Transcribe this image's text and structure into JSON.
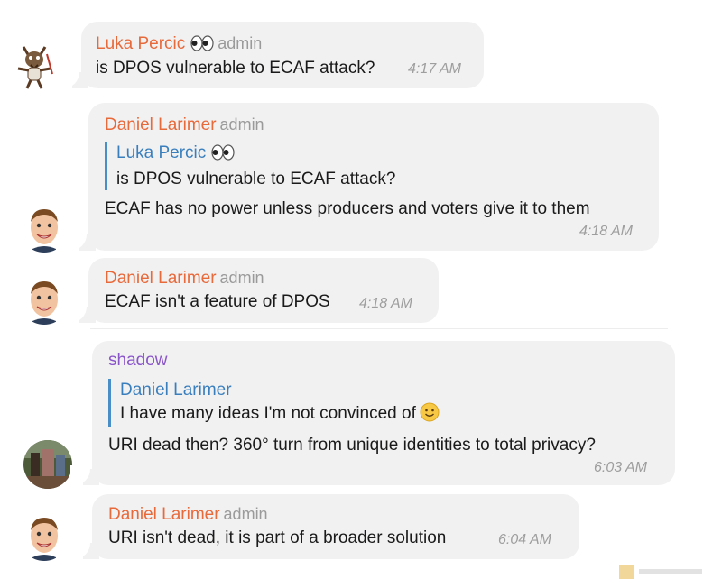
{
  "messages": [
    {
      "sender": "Luka Percic",
      "sender_emoji": "eyes-emoji",
      "role": "admin",
      "text": "is DPOS vulnerable to ECAF attack?",
      "time": "4:17 AM",
      "avatar": "cartoon-goat-avatar"
    },
    {
      "sender": "Daniel Larimer",
      "role": "admin",
      "reply_to": {
        "sender": "Luka Percic",
        "sender_emoji": "eyes-emoji",
        "text": "is DPOS vulnerable to ECAF attack?"
      },
      "text": "ECAF has no power unless producers and voters give it to them",
      "time": "4:18 AM",
      "avatar": "cartoon-man-avatar"
    },
    {
      "sender": "Daniel Larimer",
      "role": "admin",
      "text": "ECAF isn't a feature of DPOS",
      "time": "4:18 AM",
      "avatar": "cartoon-man-avatar"
    },
    {
      "sender": "shadow",
      "role": "",
      "reply_to": {
        "sender": "Daniel Larimer",
        "text": "I have many ideas I'm not convinced of",
        "text_emoji": "smiley-emoji"
      },
      "text": "URI dead then? 360° turn from unique identities to total privacy?",
      "time": "6:03 AM",
      "avatar": "photo-avatar"
    },
    {
      "sender": "Daniel Larimer",
      "role": "admin",
      "text": "URI isn't dead, it is part of a broader solution",
      "time": "6:04 AM",
      "avatar": "cartoon-man-avatar"
    }
  ],
  "colors": {
    "bubble": "#f1f1f2",
    "sender_orange": "#e8693a",
    "sender_purple": "#8a55c9",
    "reply_accent": "#4a8ec7",
    "role": "#9a9a9a",
    "time": "#9e9e9e"
  }
}
